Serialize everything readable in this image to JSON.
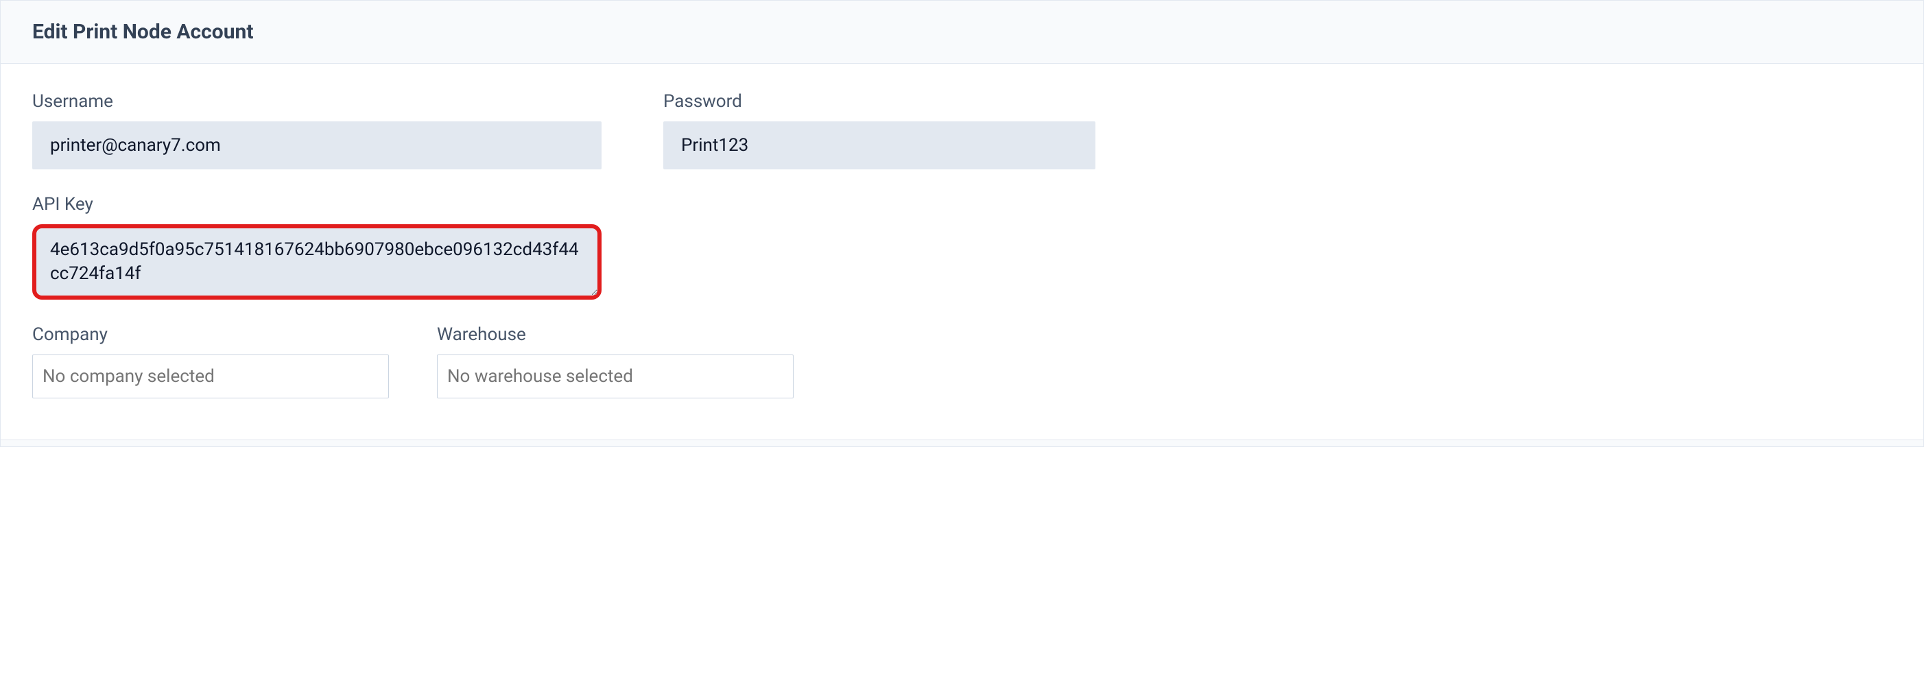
{
  "header": {
    "title": "Edit Print Node Account"
  },
  "fields": {
    "username": {
      "label": "Username",
      "value": "printer@canary7.com"
    },
    "password": {
      "label": "Password",
      "value": "Print123"
    },
    "apiKey": {
      "label": "API Key",
      "value": "4e613ca9d5f0a95c751418167624bb6907980ebce096132cd43f44cc724fa14f"
    },
    "company": {
      "label": "Company",
      "placeholder": "No company selected"
    },
    "warehouse": {
      "label": "Warehouse",
      "placeholder": "No warehouse selected"
    }
  }
}
